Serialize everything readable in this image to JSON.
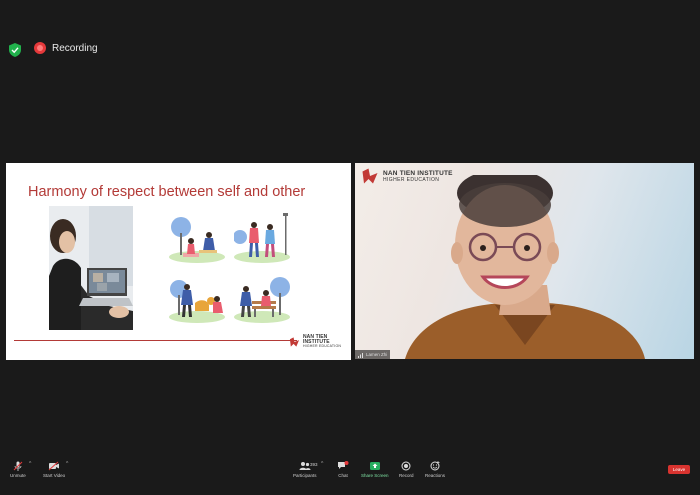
{
  "status": {
    "recording_label": "Recording",
    "colors": {
      "shield": "#21b14c",
      "recording": "#e5393b"
    }
  },
  "slide": {
    "title": "Harmony of respect between self and other",
    "logo_line1": "NAN TIEN INSTITUTE",
    "logo_line2": "HIGHER EDUCATION",
    "accent_color": "#b33a37"
  },
  "camera": {
    "logo_line1": "NAN TIEN INSTITUTE",
    "logo_line2": "HIGHER EDUCATION",
    "participant_name": "Lamen Zhi"
  },
  "toolbar": {
    "unmute_label": "Unmute",
    "start_video_label": "Start Video",
    "participants_label": "Participants",
    "participants_count": "393",
    "chat_label": "Chat",
    "chat_badge": "1",
    "share_label": "Share Screen",
    "record_label": "Record",
    "reactions_label": "Reactions",
    "leave_label": "Leave",
    "share_color": "#27ae60",
    "leave_color": "#d8332f"
  }
}
